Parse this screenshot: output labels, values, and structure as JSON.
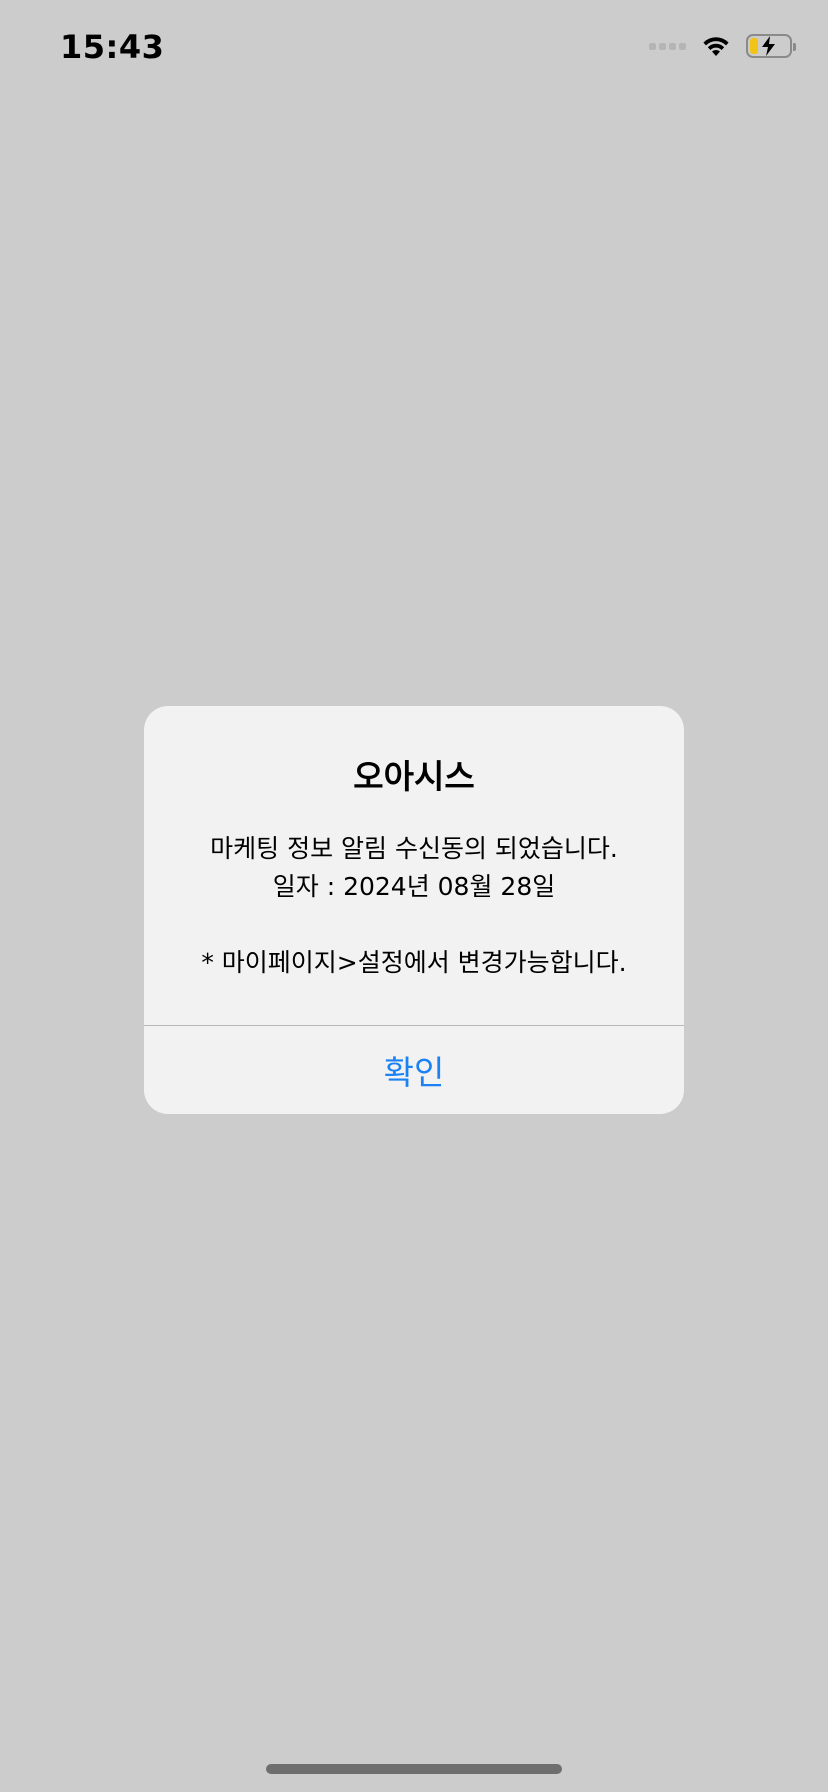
{
  "status_bar": {
    "time": "15:43",
    "icons": [
      "cellular-signal-icon",
      "wifi-icon",
      "battery-charging-icon"
    ],
    "battery_level": 0.2
  },
  "alert": {
    "title": "오아시스",
    "message_lines": [
      "마케팅 정보 알림 수신동의 되었습니다.",
      "일자 : 2024년 08월 28일",
      "",
      "* 마이페이지>설정에서 변경가능합니다."
    ],
    "confirm_label": "확인"
  },
  "colors": {
    "background": "#cccccc",
    "alert_background": "#f2f2f2",
    "accent": "#1a82f4",
    "battery": "#f2c318"
  }
}
